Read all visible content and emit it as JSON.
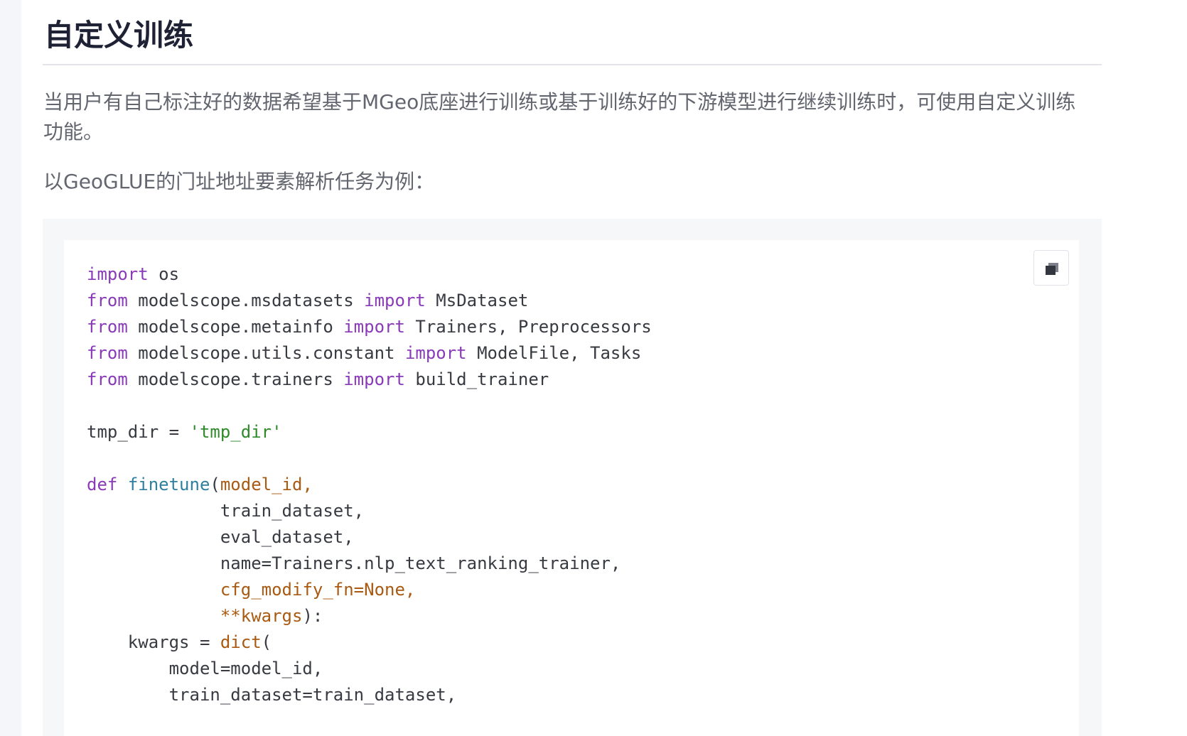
{
  "section": {
    "title": "自定义训练",
    "paragraphs": [
      "当用户有自己标注好的数据希望基于MGeo底座进行训练或基于训练好的下游模型进行继续训练时，可使用自定义训练功能。",
      "以GeoGLUE的门址地址要素解析任务为例："
    ]
  },
  "code_block": {
    "copy_button": {
      "icon": "copy-icon"
    },
    "lines": [
      [
        [
          "kw",
          "import"
        ],
        [
          "plain",
          " os"
        ]
      ],
      [
        [
          "kw",
          "from"
        ],
        [
          "plain",
          " modelscope.msdatasets "
        ],
        [
          "kw",
          "import"
        ],
        [
          "plain",
          " MsDataset"
        ]
      ],
      [
        [
          "kw",
          "from"
        ],
        [
          "plain",
          " modelscope.metainfo "
        ],
        [
          "kw",
          "import"
        ],
        [
          "plain",
          " Trainers, Preprocessors"
        ]
      ],
      [
        [
          "kw",
          "from"
        ],
        [
          "plain",
          " modelscope.utils.constant "
        ],
        [
          "kw",
          "import"
        ],
        [
          "plain",
          " ModelFile, Tasks"
        ]
      ],
      [
        [
          "kw",
          "from"
        ],
        [
          "plain",
          " modelscope.trainers "
        ],
        [
          "kw",
          "import"
        ],
        [
          "plain",
          " build_trainer"
        ]
      ],
      [],
      [
        [
          "plain",
          "tmp_dir = "
        ],
        [
          "str",
          "'tmp_dir'"
        ]
      ],
      [],
      [
        [
          "kw",
          "def"
        ],
        [
          "plain",
          " "
        ],
        [
          "fn",
          "finetune"
        ],
        [
          "plain",
          "("
        ],
        [
          "param",
          "model_id,"
        ]
      ],
      [
        [
          "plain",
          "             train_dataset,"
        ]
      ],
      [
        [
          "plain",
          "             eval_dataset,"
        ]
      ],
      [
        [
          "plain",
          "             name=Trainers.nlp_text_ranking_trainer,"
        ]
      ],
      [
        [
          "plain",
          "             "
        ],
        [
          "param",
          "cfg_modify_fn=None,"
        ]
      ],
      [
        [
          "plain",
          "             "
        ],
        [
          "param",
          "**kwargs"
        ],
        [
          "plain",
          "):"
        ]
      ],
      [
        [
          "plain",
          "    kwargs = "
        ],
        [
          "builtin",
          "dict"
        ],
        [
          "plain",
          "("
        ]
      ],
      [
        [
          "plain",
          "        model=model_id,"
        ]
      ],
      [
        [
          "plain",
          "        train_dataset=train_dataset,"
        ]
      ]
    ]
  },
  "colors": {
    "keyword": "#8a3ab9",
    "function": "#2f7fa0",
    "string": "#2f8a2a",
    "parameter": "#a95a12",
    "text": "#383a42"
  }
}
